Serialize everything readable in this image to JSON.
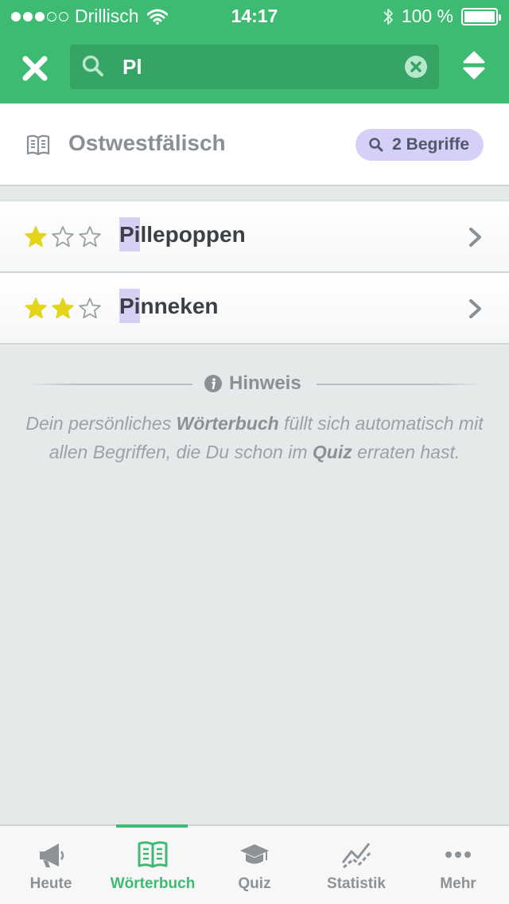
{
  "status_bar": {
    "carrier": "Drillisch",
    "time": "14:17",
    "battery": "100 %"
  },
  "search": {
    "value": "Pl"
  },
  "dictionary": {
    "title": "Ostwestfälisch",
    "count_label": "2 Begriffe"
  },
  "entries": [
    {
      "highlight": "Pi",
      "rest": "llepoppen",
      "stars": 1,
      "max_stars": 3
    },
    {
      "highlight": "Pi",
      "rest": "nneken",
      "stars": 2,
      "max_stars": 3
    }
  ],
  "hint": {
    "title": "Hinweis",
    "text_1": "Dein persönliches ",
    "bold_1": "Wörterbuch",
    "text_2": " füllt sich automatisch mit allen Begriffen, die Du schon im ",
    "bold_2": "Quiz",
    "text_3": " erraten hast."
  },
  "tabs": [
    {
      "label": "Heute",
      "icon": "megaphone-icon"
    },
    {
      "label": "Wörterbuch",
      "icon": "book-icon",
      "active": true
    },
    {
      "label": "Quiz",
      "icon": "graduation-cap-icon"
    },
    {
      "label": "Statistik",
      "icon": "chart-line-icon"
    },
    {
      "label": "Mehr",
      "icon": "more-dots-icon"
    }
  ],
  "colors": {
    "brand_green": "#3dbb73",
    "highlight": "#d6d0f5",
    "star_filled": "#e4d41c"
  }
}
